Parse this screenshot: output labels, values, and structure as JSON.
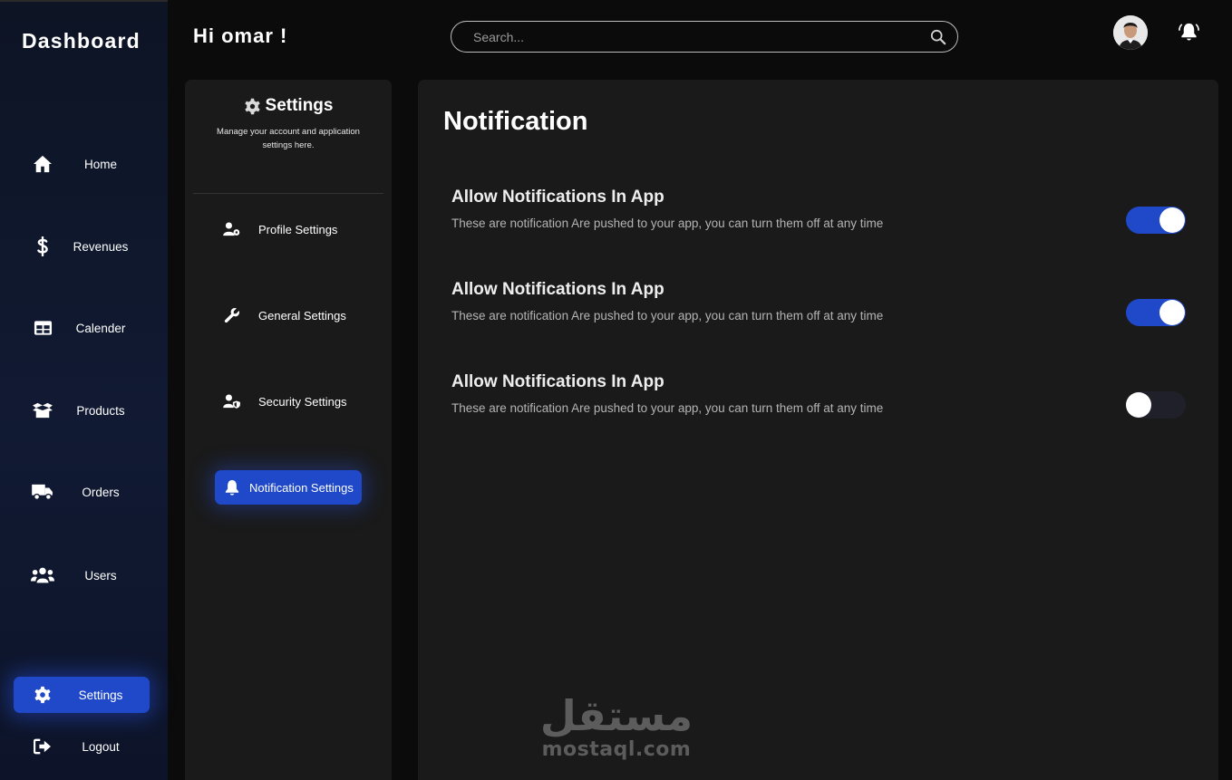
{
  "sidebar": {
    "brand": "Dashboard",
    "items": [
      {
        "label": "Home",
        "icon": "home-icon"
      },
      {
        "label": "Revenues",
        "icon": "dollar-icon"
      },
      {
        "label": "Calender",
        "icon": "table-icon"
      },
      {
        "label": "Products",
        "icon": "box-icon"
      },
      {
        "label": "Orders",
        "icon": "truck-icon"
      },
      {
        "label": "Users",
        "icon": "users-icon"
      },
      {
        "label": "Settings",
        "icon": "gear-icon",
        "active": true
      },
      {
        "label": "Logout",
        "icon": "logout-icon"
      }
    ]
  },
  "header": {
    "greeting": "Hi omar !",
    "search_placeholder": "Search..."
  },
  "settings_panel": {
    "title": "Settings",
    "description": "Manage your account and application settings here.",
    "items": [
      {
        "label": "Profile Settings",
        "icon": "user-gear-icon"
      },
      {
        "label": "General Settings",
        "icon": "wrench-icon"
      },
      {
        "label": "Security Settings",
        "icon": "user-shield-icon"
      },
      {
        "label": "Notification Settings",
        "icon": "bell-icon",
        "active": true
      }
    ]
  },
  "main": {
    "title": "Notification",
    "notifications": [
      {
        "title": "Allow Notifications In App",
        "description": "These are notification Are pushed to your app, you can turn them off at any time",
        "enabled": true
      },
      {
        "title": "Allow Notifications In App",
        "description": "These are notification Are pushed to your app, you can turn them off at any time",
        "enabled": true
      },
      {
        "title": "Allow Notifications In App",
        "description": "These are notification Are pushed to your app, you can turn them off at any time",
        "enabled": false
      }
    ]
  },
  "watermark": {
    "arabic": "مستقل",
    "latin": "mostaql.com"
  },
  "colors": {
    "accent": "#1f49c9",
    "panel": "#1a1a1a",
    "background": "#0b0b0b"
  }
}
